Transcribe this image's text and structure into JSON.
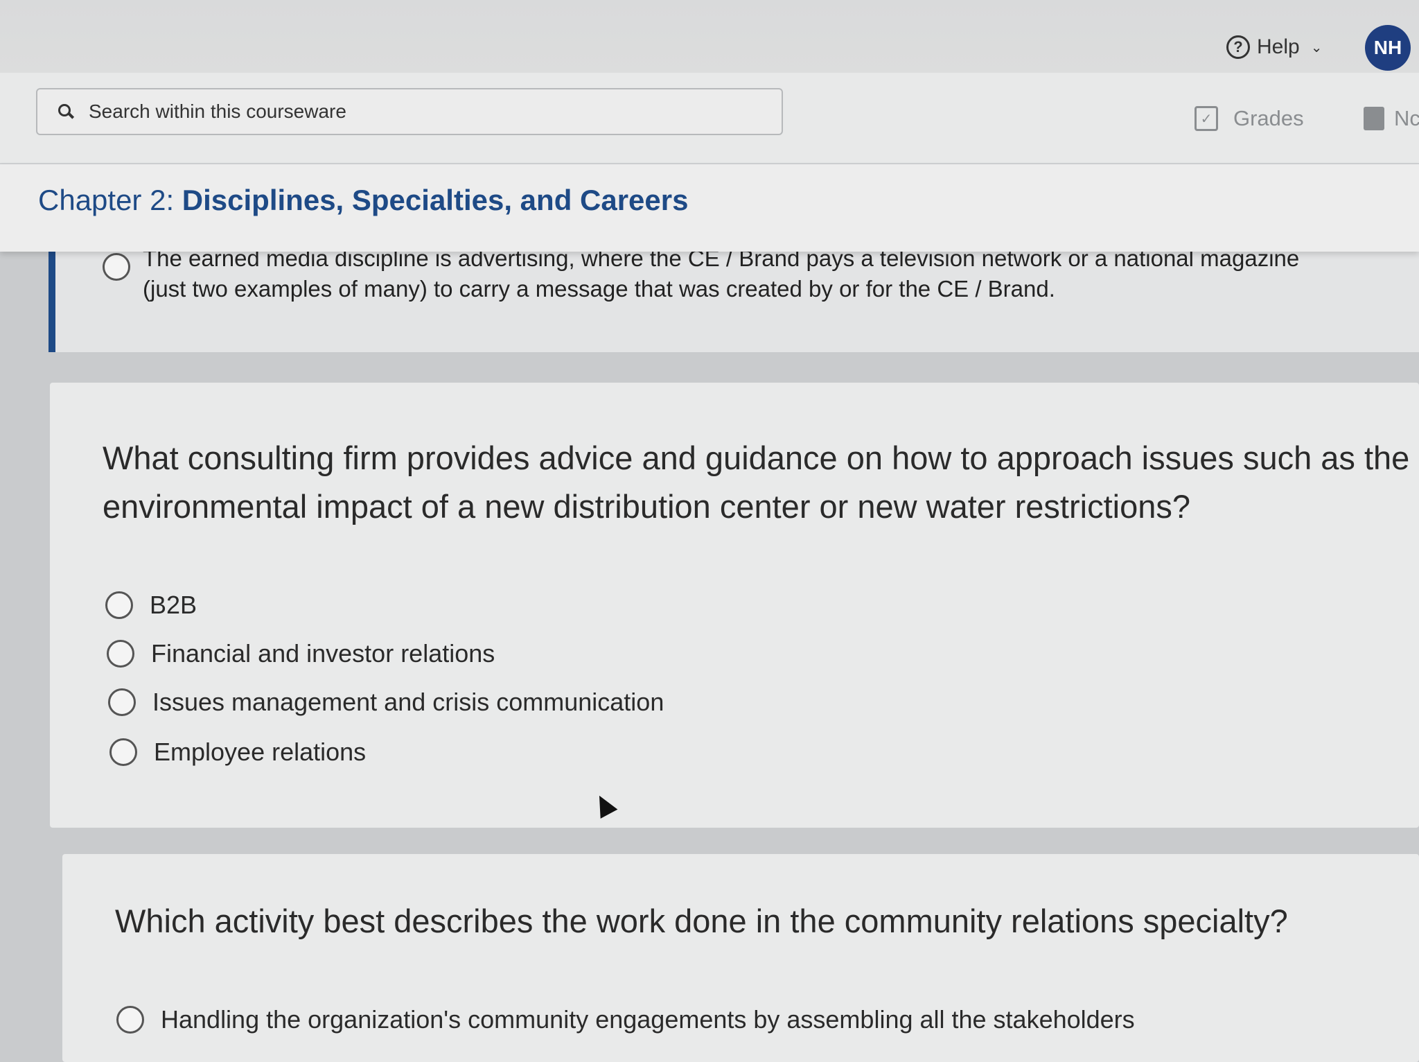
{
  "header": {
    "help_label": "Help",
    "help_chevron": "⌄",
    "avatar_initials": "NH",
    "search_placeholder": "Search within this courseware",
    "grades_label": "Grades",
    "notes_label": "Nc"
  },
  "chapter": {
    "prefix": "Chapter 2: ",
    "title": "Disciplines, Specialties, and Careers"
  },
  "previous_question": {
    "option_text_line1": "The earned media discipline is advertising, where the CE / Brand pays a television network or a national magazine",
    "option_text_line2": "(just two examples of many) to carry a message that was created by or for the CE / Brand."
  },
  "question1": {
    "line1": "What consulting firm provides advice and guidance on how to approach issues such as the",
    "line2": "environmental impact of a new distribution center or new water restrictions?",
    "options": [
      "B2B",
      "Financial and investor relations",
      "Issues management and crisis communication",
      "Employee relations"
    ]
  },
  "question2": {
    "text": "Which activity best describes the work done in the community relations specialty?",
    "options": [
      "Handling the organization's community engagements by assembling all the stakeholders"
    ]
  },
  "colors": {
    "brand": "#1e4a86",
    "avatar_bg": "#1f3e80",
    "muted": "#8a8d90"
  }
}
